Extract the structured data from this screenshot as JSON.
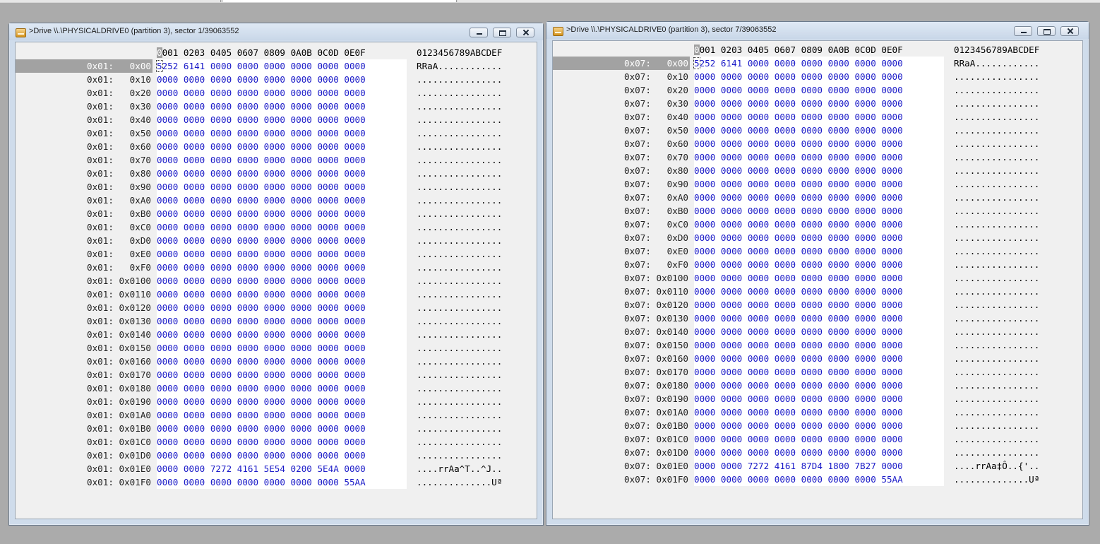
{
  "windows": [
    {
      "title": ">Drive \\\\.\\PHYSICALDRIVE0 (partition 3), sector 1/39063552",
      "column_header": "0001 0203 0405 0607 0809 0A0B 0C0D 0E0F",
      "ascii_header": "0123456789ABCDEF",
      "selected_row": 0,
      "rows": [
        {
          "addr": "0x01:   0x00",
          "bytes": "5252 6141 0000 0000 0000 0000 0000 0000",
          "ascii": "RRaA............"
        },
        {
          "addr": "0x01:   0x10",
          "bytes": "0000 0000 0000 0000 0000 0000 0000 0000",
          "ascii": "................"
        },
        {
          "addr": "0x01:   0x20",
          "bytes": "0000 0000 0000 0000 0000 0000 0000 0000",
          "ascii": "................"
        },
        {
          "addr": "0x01:   0x30",
          "bytes": "0000 0000 0000 0000 0000 0000 0000 0000",
          "ascii": "................"
        },
        {
          "addr": "0x01:   0x40",
          "bytes": "0000 0000 0000 0000 0000 0000 0000 0000",
          "ascii": "................"
        },
        {
          "addr": "0x01:   0x50",
          "bytes": "0000 0000 0000 0000 0000 0000 0000 0000",
          "ascii": "................"
        },
        {
          "addr": "0x01:   0x60",
          "bytes": "0000 0000 0000 0000 0000 0000 0000 0000",
          "ascii": "................"
        },
        {
          "addr": "0x01:   0x70",
          "bytes": "0000 0000 0000 0000 0000 0000 0000 0000",
          "ascii": "................"
        },
        {
          "addr": "0x01:   0x80",
          "bytes": "0000 0000 0000 0000 0000 0000 0000 0000",
          "ascii": "................"
        },
        {
          "addr": "0x01:   0x90",
          "bytes": "0000 0000 0000 0000 0000 0000 0000 0000",
          "ascii": "................"
        },
        {
          "addr": "0x01:   0xA0",
          "bytes": "0000 0000 0000 0000 0000 0000 0000 0000",
          "ascii": "................"
        },
        {
          "addr": "0x01:   0xB0",
          "bytes": "0000 0000 0000 0000 0000 0000 0000 0000",
          "ascii": "................"
        },
        {
          "addr": "0x01:   0xC0",
          "bytes": "0000 0000 0000 0000 0000 0000 0000 0000",
          "ascii": "................"
        },
        {
          "addr": "0x01:   0xD0",
          "bytes": "0000 0000 0000 0000 0000 0000 0000 0000",
          "ascii": "................"
        },
        {
          "addr": "0x01:   0xE0",
          "bytes": "0000 0000 0000 0000 0000 0000 0000 0000",
          "ascii": "................"
        },
        {
          "addr": "0x01:   0xF0",
          "bytes": "0000 0000 0000 0000 0000 0000 0000 0000",
          "ascii": "................"
        },
        {
          "addr": "0x01: 0x0100",
          "bytes": "0000 0000 0000 0000 0000 0000 0000 0000",
          "ascii": "................"
        },
        {
          "addr": "0x01: 0x0110",
          "bytes": "0000 0000 0000 0000 0000 0000 0000 0000",
          "ascii": "................"
        },
        {
          "addr": "0x01: 0x0120",
          "bytes": "0000 0000 0000 0000 0000 0000 0000 0000",
          "ascii": "................"
        },
        {
          "addr": "0x01: 0x0130",
          "bytes": "0000 0000 0000 0000 0000 0000 0000 0000",
          "ascii": "................"
        },
        {
          "addr": "0x01: 0x0140",
          "bytes": "0000 0000 0000 0000 0000 0000 0000 0000",
          "ascii": "................"
        },
        {
          "addr": "0x01: 0x0150",
          "bytes": "0000 0000 0000 0000 0000 0000 0000 0000",
          "ascii": "................"
        },
        {
          "addr": "0x01: 0x0160",
          "bytes": "0000 0000 0000 0000 0000 0000 0000 0000",
          "ascii": "................"
        },
        {
          "addr": "0x01: 0x0170",
          "bytes": "0000 0000 0000 0000 0000 0000 0000 0000",
          "ascii": "................"
        },
        {
          "addr": "0x01: 0x0180",
          "bytes": "0000 0000 0000 0000 0000 0000 0000 0000",
          "ascii": "................"
        },
        {
          "addr": "0x01: 0x0190",
          "bytes": "0000 0000 0000 0000 0000 0000 0000 0000",
          "ascii": "................"
        },
        {
          "addr": "0x01: 0x01A0",
          "bytes": "0000 0000 0000 0000 0000 0000 0000 0000",
          "ascii": "................"
        },
        {
          "addr": "0x01: 0x01B0",
          "bytes": "0000 0000 0000 0000 0000 0000 0000 0000",
          "ascii": "................"
        },
        {
          "addr": "0x01: 0x01C0",
          "bytes": "0000 0000 0000 0000 0000 0000 0000 0000",
          "ascii": "................"
        },
        {
          "addr": "0x01: 0x01D0",
          "bytes": "0000 0000 0000 0000 0000 0000 0000 0000",
          "ascii": "................"
        },
        {
          "addr": "0x01: 0x01E0",
          "bytes": "0000 0000 7272 4161 5E54 0200 5E4A 0000",
          "ascii": "....rrAa^T..^J.."
        },
        {
          "addr": "0x01: 0x01F0",
          "bytes": "0000 0000 0000 0000 0000 0000 0000 55AA",
          "ascii": "..............Uª"
        }
      ]
    },
    {
      "title": ">Drive \\\\.\\PHYSICALDRIVE0 (partition 3), sector 7/39063552",
      "column_header": "0001 0203 0405 0607 0809 0A0B 0C0D 0E0F",
      "ascii_header": "0123456789ABCDEF",
      "selected_row": 0,
      "rows": [
        {
          "addr": "0x07:   0x00",
          "bytes": "5252 6141 0000 0000 0000 0000 0000 0000",
          "ascii": "RRaA............"
        },
        {
          "addr": "0x07:   0x10",
          "bytes": "0000 0000 0000 0000 0000 0000 0000 0000",
          "ascii": "................"
        },
        {
          "addr": "0x07:   0x20",
          "bytes": "0000 0000 0000 0000 0000 0000 0000 0000",
          "ascii": "................"
        },
        {
          "addr": "0x07:   0x30",
          "bytes": "0000 0000 0000 0000 0000 0000 0000 0000",
          "ascii": "................"
        },
        {
          "addr": "0x07:   0x40",
          "bytes": "0000 0000 0000 0000 0000 0000 0000 0000",
          "ascii": "................"
        },
        {
          "addr": "0x07:   0x50",
          "bytes": "0000 0000 0000 0000 0000 0000 0000 0000",
          "ascii": "................"
        },
        {
          "addr": "0x07:   0x60",
          "bytes": "0000 0000 0000 0000 0000 0000 0000 0000",
          "ascii": "................"
        },
        {
          "addr": "0x07:   0x70",
          "bytes": "0000 0000 0000 0000 0000 0000 0000 0000",
          "ascii": "................"
        },
        {
          "addr": "0x07:   0x80",
          "bytes": "0000 0000 0000 0000 0000 0000 0000 0000",
          "ascii": "................"
        },
        {
          "addr": "0x07:   0x90",
          "bytes": "0000 0000 0000 0000 0000 0000 0000 0000",
          "ascii": "................"
        },
        {
          "addr": "0x07:   0xA0",
          "bytes": "0000 0000 0000 0000 0000 0000 0000 0000",
          "ascii": "................"
        },
        {
          "addr": "0x07:   0xB0",
          "bytes": "0000 0000 0000 0000 0000 0000 0000 0000",
          "ascii": "................"
        },
        {
          "addr": "0x07:   0xC0",
          "bytes": "0000 0000 0000 0000 0000 0000 0000 0000",
          "ascii": "................"
        },
        {
          "addr": "0x07:   0xD0",
          "bytes": "0000 0000 0000 0000 0000 0000 0000 0000",
          "ascii": "................"
        },
        {
          "addr": "0x07:   0xE0",
          "bytes": "0000 0000 0000 0000 0000 0000 0000 0000",
          "ascii": "................"
        },
        {
          "addr": "0x07:   0xF0",
          "bytes": "0000 0000 0000 0000 0000 0000 0000 0000",
          "ascii": "................"
        },
        {
          "addr": "0x07: 0x0100",
          "bytes": "0000 0000 0000 0000 0000 0000 0000 0000",
          "ascii": "................"
        },
        {
          "addr": "0x07: 0x0110",
          "bytes": "0000 0000 0000 0000 0000 0000 0000 0000",
          "ascii": "................"
        },
        {
          "addr": "0x07: 0x0120",
          "bytes": "0000 0000 0000 0000 0000 0000 0000 0000",
          "ascii": "................"
        },
        {
          "addr": "0x07: 0x0130",
          "bytes": "0000 0000 0000 0000 0000 0000 0000 0000",
          "ascii": "................"
        },
        {
          "addr": "0x07: 0x0140",
          "bytes": "0000 0000 0000 0000 0000 0000 0000 0000",
          "ascii": "................"
        },
        {
          "addr": "0x07: 0x0150",
          "bytes": "0000 0000 0000 0000 0000 0000 0000 0000",
          "ascii": "................"
        },
        {
          "addr": "0x07: 0x0160",
          "bytes": "0000 0000 0000 0000 0000 0000 0000 0000",
          "ascii": "................"
        },
        {
          "addr": "0x07: 0x0170",
          "bytes": "0000 0000 0000 0000 0000 0000 0000 0000",
          "ascii": "................"
        },
        {
          "addr": "0x07: 0x0180",
          "bytes": "0000 0000 0000 0000 0000 0000 0000 0000",
          "ascii": "................"
        },
        {
          "addr": "0x07: 0x0190",
          "bytes": "0000 0000 0000 0000 0000 0000 0000 0000",
          "ascii": "................"
        },
        {
          "addr": "0x07: 0x01A0",
          "bytes": "0000 0000 0000 0000 0000 0000 0000 0000",
          "ascii": "................"
        },
        {
          "addr": "0x07: 0x01B0",
          "bytes": "0000 0000 0000 0000 0000 0000 0000 0000",
          "ascii": "................"
        },
        {
          "addr": "0x07: 0x01C0",
          "bytes": "0000 0000 0000 0000 0000 0000 0000 0000",
          "ascii": "................"
        },
        {
          "addr": "0x07: 0x01D0",
          "bytes": "0000 0000 0000 0000 0000 0000 0000 0000",
          "ascii": "................"
        },
        {
          "addr": "0x07: 0x01E0",
          "bytes": "0000 0000 7272 4161 87D4 1800 7B27 0000",
          "ascii": "....rrAa‡Ô..{'.."
        },
        {
          "addr": "0x07: 0x01F0",
          "bytes": "0000 0000 0000 0000 0000 0000 0000 55AA",
          "ascii": "..............Uª"
        }
      ]
    }
  ],
  "icons": {
    "window_icon": "drive-icon",
    "minimize": "minimize-icon",
    "maximize": "maximize-icon",
    "close": "close-icon"
  },
  "colors": {
    "hex_bytes": "#1a1ac8",
    "selection": "#a2a2a2",
    "background": "#ababab"
  }
}
